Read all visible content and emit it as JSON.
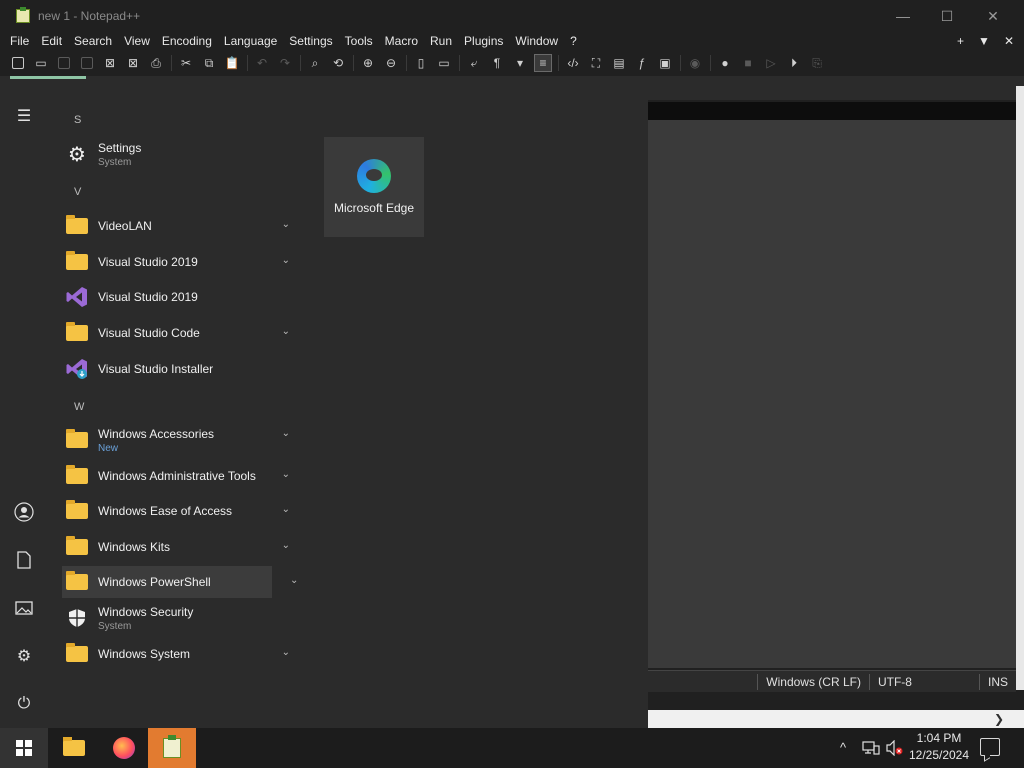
{
  "window": {
    "title": "new 1 - Notepad++",
    "controls": {
      "minimize": "—",
      "maximize": "☐",
      "close": "✕"
    }
  },
  "menubar": {
    "items": [
      "File",
      "Edit",
      "Search",
      "View",
      "Encoding",
      "Language",
      "Settings",
      "Tools",
      "Macro",
      "Run",
      "Plugins",
      "Window",
      "?"
    ],
    "right": {
      "add": "+",
      "dropdown": "▼",
      "close": "✕"
    }
  },
  "statusbar": {
    "eol": "Windows (CR LF)",
    "encoding": "UTF-8",
    "mode": "INS"
  },
  "startmenu": {
    "sections": [
      {
        "letter": "S"
      },
      {
        "letter": "V"
      },
      {
        "letter": "W"
      }
    ],
    "apps": [
      {
        "name": "Settings",
        "sub": "System",
        "icon": "gear-icon"
      },
      {
        "name": "VideoLAN",
        "icon": "folder-icon",
        "expandable": true
      },
      {
        "name": "Visual Studio 2019",
        "icon": "folder-icon",
        "expandable": true
      },
      {
        "name": "Visual Studio 2019",
        "icon": "visual-studio-icon"
      },
      {
        "name": "Visual Studio Code",
        "icon": "folder-icon",
        "expandable": true
      },
      {
        "name": "Visual Studio Installer",
        "icon": "visual-studio-installer-icon"
      },
      {
        "name": "Windows Accessories",
        "sub": "New",
        "icon": "folder-icon",
        "expandable": true
      },
      {
        "name": "Windows Administrative Tools",
        "icon": "folder-icon",
        "expandable": true
      },
      {
        "name": "Windows Ease of Access",
        "icon": "folder-icon",
        "expandable": true
      },
      {
        "name": "Windows Kits",
        "icon": "folder-icon",
        "expandable": true
      },
      {
        "name": "Windows PowerShell",
        "icon": "folder-icon",
        "expandable": true
      },
      {
        "name": "Windows Security",
        "sub": "System",
        "icon": "shield-icon"
      },
      {
        "name": "Windows System",
        "icon": "folder-icon",
        "expandable": true
      }
    ],
    "pinned": {
      "label": "Microsoft Edge",
      "icon": "edge-icon"
    },
    "rail": {
      "menu": "☰",
      "user": "👤",
      "documents": "🗋",
      "pictures": "🖼",
      "settings": "⚙",
      "power": "⏻"
    }
  },
  "taskbar": {
    "clock": {
      "time": "1:04 PM",
      "date": "12/25/2024"
    },
    "tray": {
      "overflow": "^",
      "network": "🖧",
      "volume": "🔇"
    }
  }
}
